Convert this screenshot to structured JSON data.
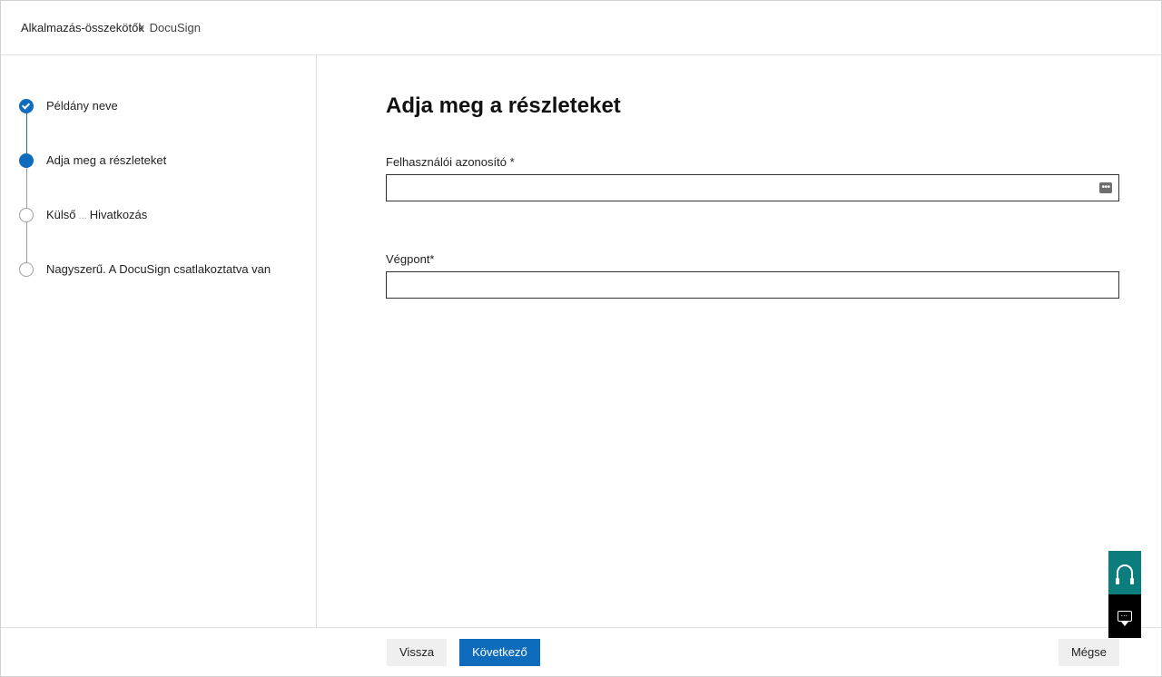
{
  "header": {
    "breadcrumb_root": "Alkalmazás-összekötők",
    "breadcrumb_current": "DocuSign"
  },
  "sidebar": {
    "steps": [
      {
        "label": "Példány neve",
        "state": "completed"
      },
      {
        "label": "Adja meg a részleteket",
        "state": "current"
      },
      {
        "label_prefix": "Külső",
        "label_extra": "...",
        "label_suffix": "Hivatkozás",
        "state": "pending"
      },
      {
        "label": "Nagyszerű. A DocuSign csatlakoztatva van",
        "state": "pending"
      }
    ]
  },
  "main": {
    "title": "Adja meg a részleteket",
    "fields": {
      "user_id": {
        "label": "Felhasználói azonosító *",
        "value": ""
      },
      "endpoint": {
        "label": "Végpont*",
        "value": ""
      }
    }
  },
  "footer": {
    "back_label": "Vissza",
    "next_label": "Következő",
    "cancel_label": "Mégse"
  }
}
